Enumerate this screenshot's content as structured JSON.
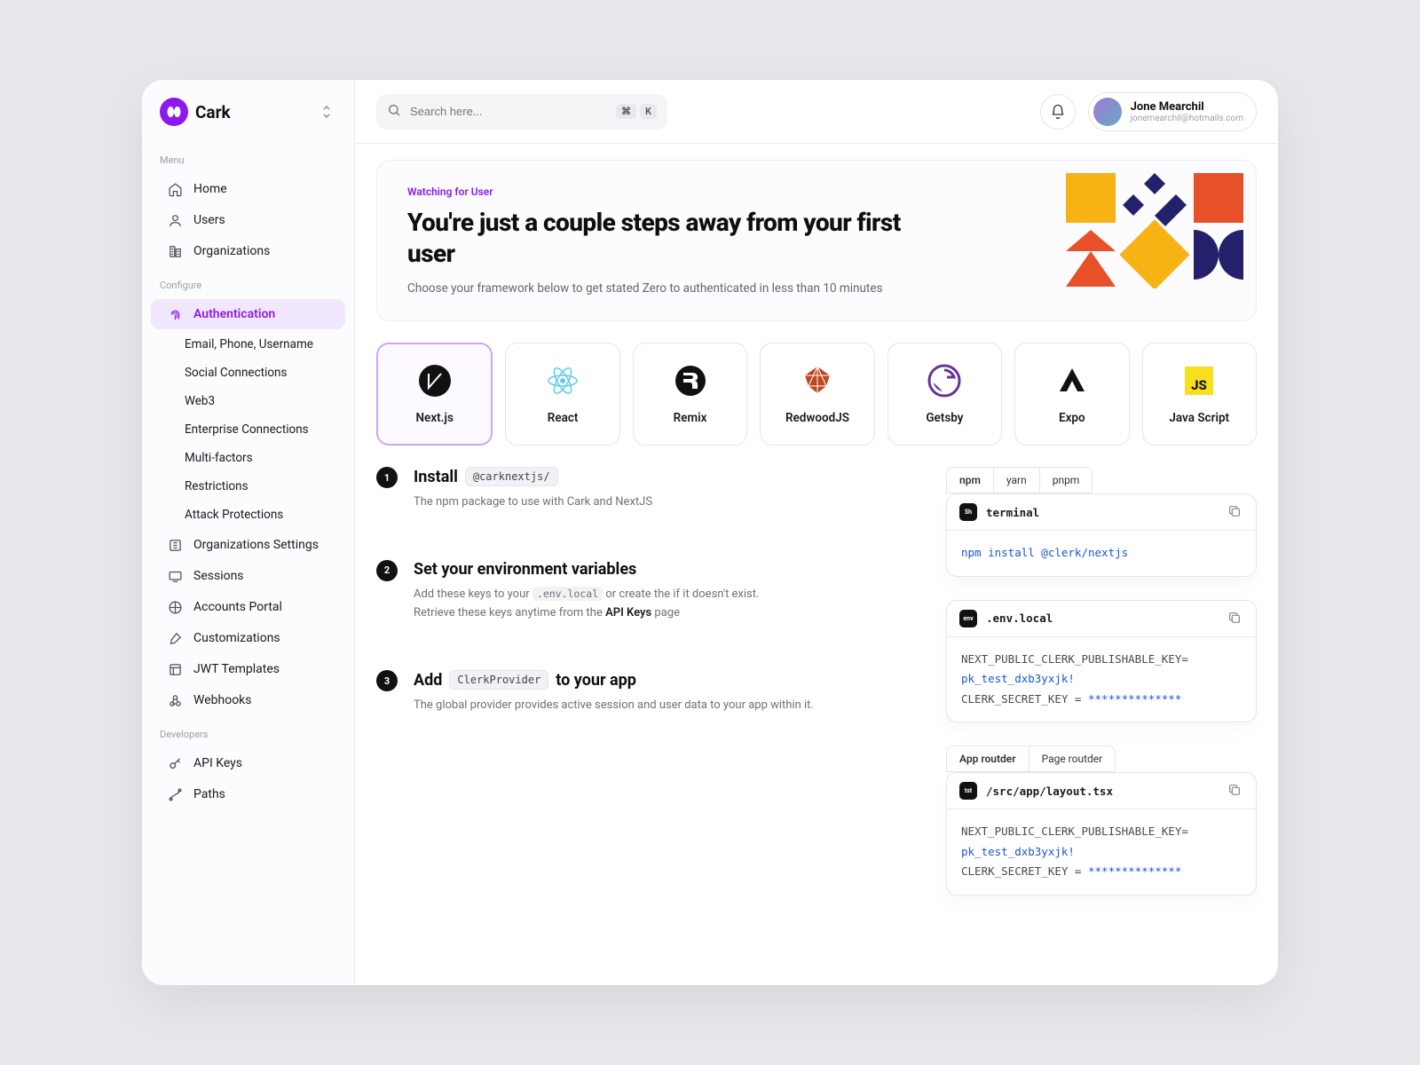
{
  "brand": {
    "name": "Cark"
  },
  "search": {
    "placeholder": "Search here...",
    "shortcut1": "⌘",
    "shortcut2": "K"
  },
  "user": {
    "name": "Jone Mearchil",
    "email": "jonemearchil@hotmails.com"
  },
  "sidebar": {
    "menuLabel": "Menu",
    "configureLabel": "Configure",
    "developersLabel": "Developers",
    "menu": [
      "Home",
      "Users",
      "Organizations"
    ],
    "configure": {
      "main": "Authentication",
      "subs": [
        "Email, Phone, Username",
        "Social Connections",
        "Web3",
        "Enterprise Connections",
        "Multi-factors",
        "Restrictions",
        "Attack Protections"
      ],
      "rest": [
        "Organizations Settings",
        "Sessions",
        "Accounts Portal",
        "Customizations",
        "JWT Templates",
        "Webhooks"
      ]
    },
    "developers": [
      "API Keys",
      "Paths"
    ]
  },
  "hero": {
    "eyebrow": "Watching for User",
    "title": "You're just a couple steps away from your first user",
    "sub": "Choose your framework below to get stated Zero to authenticated in less than 10 minutes"
  },
  "frameworks": [
    "Next.js",
    "React",
    "Remix",
    "RedwoodJS",
    "Getsby",
    "Expo",
    "Java Script"
  ],
  "steps": [
    {
      "n": "1",
      "title": "Install",
      "code": "@carknextjs/",
      "desc": "The npm package to use with Cark and NextJS"
    },
    {
      "n": "2",
      "title": "Set your environment variables",
      "desc1": "Add these keys to your ",
      "code1": ".env.local",
      "desc2": " or create the if it doesn't exist.",
      "desc3": "Retrieve these keys anytime from the ",
      "bold": "API Keys",
      "desc4": " page"
    },
    {
      "n": "3",
      "title": "Add ",
      "code": "ClerkProvider",
      "title2": " to your app",
      "desc": "The global provider provides active session and user data to your app within it."
    }
  ],
  "pkgTabs": [
    "npm",
    "yarn",
    "pnpm"
  ],
  "routerTabs": [
    "App routder",
    "Page routder"
  ],
  "codeCards": [
    {
      "badge": "Sh",
      "file": "terminal",
      "body": [
        {
          "t": "npm install @clerk/nextjs",
          "c": "bl"
        }
      ]
    },
    {
      "badge": "env",
      "file": ".env.local",
      "body": [
        {
          "t": "NEXT_PUBLIC_CLERK_PUBLISHABLE_KEY=",
          "c": "gr"
        },
        {
          "t": "pk_test_dxb3yxjk!",
          "c": "bl"
        },
        {
          "t": " ",
          "c": "gr"
        },
        {
          "t": "CLERK_SECRET_KEY = ",
          "c": "gr",
          "inline": true
        },
        {
          "t": "**************",
          "c": "bl",
          "inline": true
        }
      ]
    },
    {
      "badge": "tst",
      "file": "/src/app/layout.tsx",
      "body": [
        {
          "t": "NEXT_PUBLIC_CLERK_PUBLISHABLE_KEY=",
          "c": "gr"
        },
        {
          "t": "pk_test_dxb3yxjk!",
          "c": "bl"
        },
        {
          "t": " ",
          "c": "gr"
        },
        {
          "t": "CLERK_SECRET_KEY = ",
          "c": "gr",
          "inline": true
        },
        {
          "t": "**************",
          "c": "bl",
          "inline": true
        }
      ]
    }
  ]
}
